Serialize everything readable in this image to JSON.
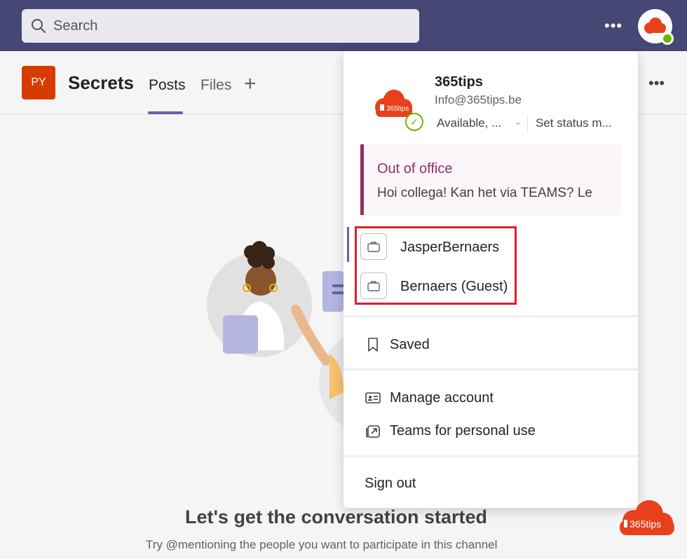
{
  "topbar": {
    "search_placeholder": "Search",
    "more_label": "•••",
    "icons": {
      "search": "search-icon",
      "more": "more-horizontal-icon",
      "avatar": "user-avatar"
    },
    "brand_color": "#464775"
  },
  "channel": {
    "team_initials": "PY",
    "team_color": "#d83b01",
    "name": "Secrets",
    "tabs": [
      {
        "label": "Posts",
        "active": true
      },
      {
        "label": "Files",
        "active": false
      }
    ],
    "add_tab_label": "+",
    "more_label": "•••"
  },
  "main": {
    "title": "Let's get the conversation started",
    "subtitle": "Try @mentioning the people you want to participate in this channel"
  },
  "profile_menu": {
    "name": "365tips",
    "email": "Info@365tips.be",
    "availability": "Available, ...",
    "set_status": "Set status m...",
    "status_color": "#6bb700",
    "out_of_office": {
      "title": "Out of office",
      "message": "Hoi collega! Kan het via TEAMS? Le",
      "accent_color": "#8f2f6b"
    },
    "accounts": [
      {
        "label": "JasperBernaers",
        "icon": "briefcase-icon"
      },
      {
        "label": "Bernaers (Guest)",
        "icon": "briefcase-icon"
      }
    ],
    "highlight_color": "#d9222a",
    "items": {
      "saved": "Saved",
      "manage_account": "Manage account",
      "teams_personal": "Teams for personal use",
      "sign_out": "Sign out"
    }
  },
  "watermark": {
    "text": "365tips"
  }
}
